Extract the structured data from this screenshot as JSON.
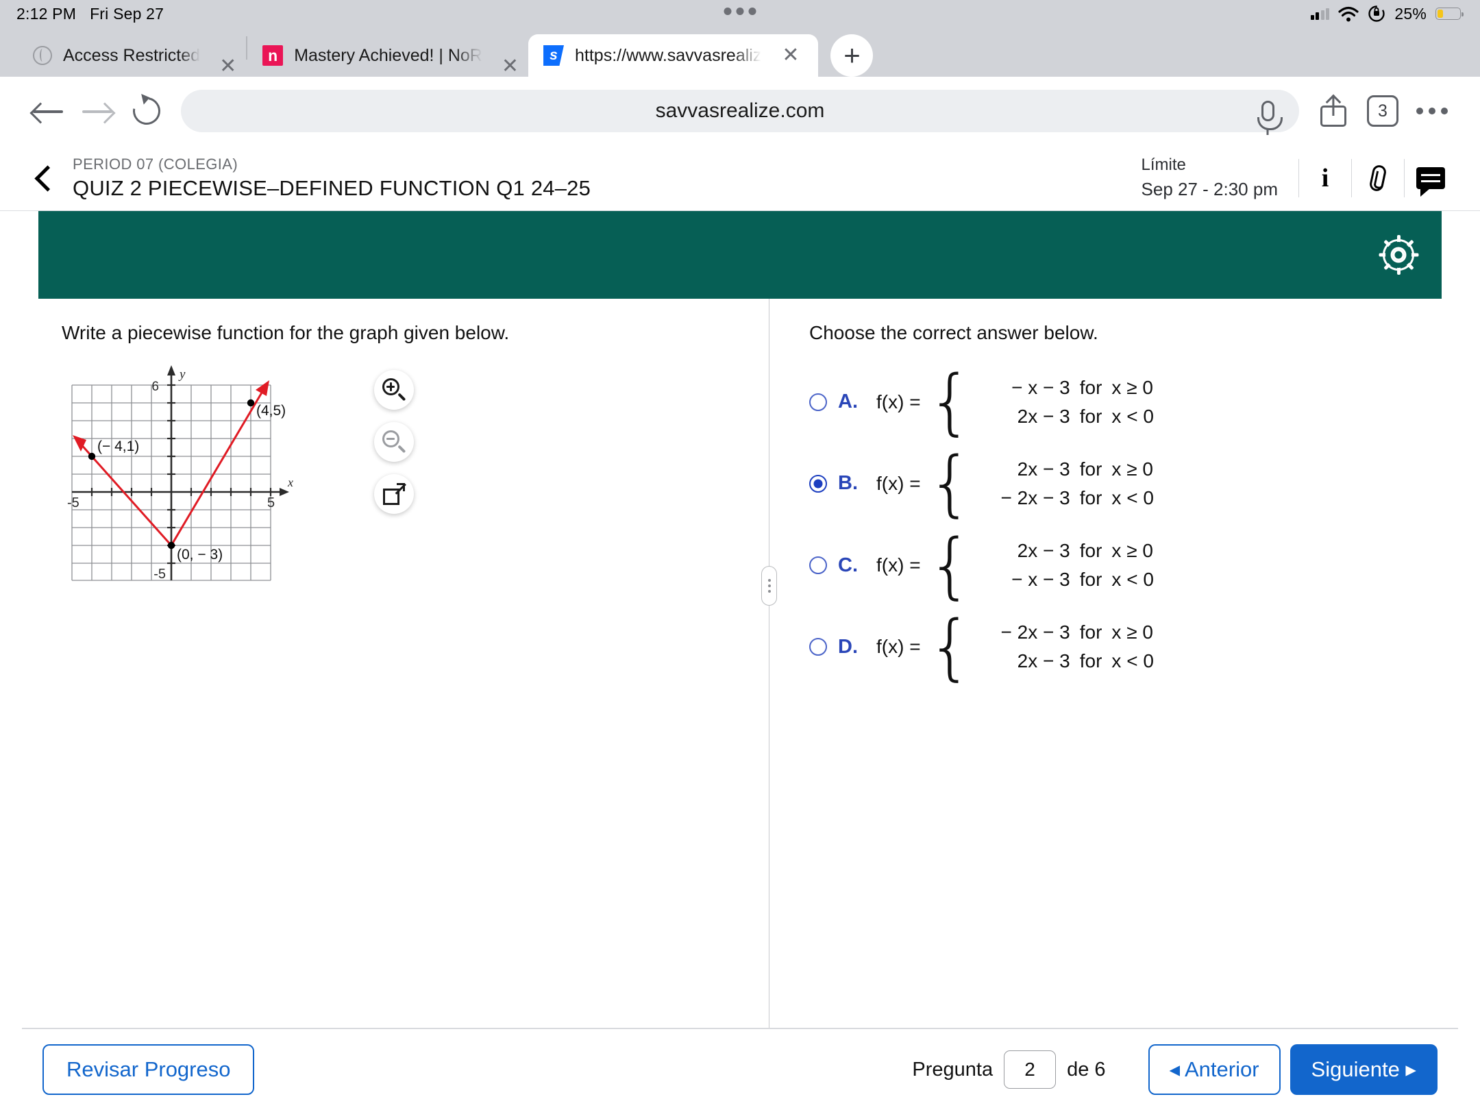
{
  "status_bar": {
    "time": "2:12 PM",
    "date": "Fri Sep 27",
    "battery_percent": "25%",
    "wifi_icon": "wifi-icon",
    "signal_icon": "cellular-signal-icon",
    "orientation_lock_icon": "rotation-lock-icon",
    "battery_icon": "battery-icon"
  },
  "browser": {
    "tabs": [
      {
        "title": "Access Restricted",
        "favicon": "globe-icon",
        "active": false
      },
      {
        "title": "Mastery Achieved! | NoR",
        "favicon": "notion-n-icon",
        "active": false
      },
      {
        "title": "https://www.savvasrealiz",
        "favicon": "savvas-s-icon",
        "active": true
      }
    ],
    "new_tab_label": "+",
    "close_label": "✕",
    "url": "savvasrealize.com",
    "tab_count": "3",
    "back_icon": "back-arrow-icon",
    "forward_icon": "forward-arrow-icon",
    "reload_icon": "reload-icon",
    "mic_icon": "microphone-icon",
    "share_icon": "share-icon",
    "more_icon": "more-options-icon"
  },
  "app_header": {
    "back_icon": "chevron-left-icon",
    "period": "PERIOD 07 (COLEGIA)",
    "title": "QUIZ 2 PIECEWISE–DEFINED FUNCTION Q1 24–25",
    "due_label": "Límite",
    "due_value": "Sep 27 - 2:30 pm",
    "info_icon": "info-icon",
    "attachment_icon": "paperclip-icon",
    "chat_icon": "chat-bubble-icon",
    "settings_icon": "gear-icon",
    "banner_color": "#065f55"
  },
  "question": {
    "prompt": "Write a piecewise function for the graph given below.",
    "choose_prompt": "Choose the correct answer below.",
    "tools": {
      "zoom_in_icon": "zoom-in-icon",
      "zoom_out_icon": "zoom-out-icon",
      "expand_icon": "open-in-new-icon"
    },
    "options": [
      {
        "letter": "A.",
        "fx": "f(x) =",
        "selected": false,
        "cases": [
          {
            "rhs": "− x − 3",
            "cond": "x ≥ 0"
          },
          {
            "rhs": "2x − 3",
            "cond": "x < 0"
          }
        ]
      },
      {
        "letter": "B.",
        "fx": "f(x) =",
        "selected": true,
        "cases": [
          {
            "rhs": "2x − 3",
            "cond": "x ≥ 0"
          },
          {
            "rhs": "− 2x − 3",
            "cond": "x < 0"
          }
        ]
      },
      {
        "letter": "C.",
        "fx": "f(x) =",
        "selected": false,
        "cases": [
          {
            "rhs": "2x − 3",
            "cond": "x ≥ 0"
          },
          {
            "rhs": "− x − 3",
            "cond": "x < 0"
          }
        ]
      },
      {
        "letter": "D.",
        "fx": "f(x) =",
        "selected": false,
        "cases": [
          {
            "rhs": "− 2x − 3",
            "cond": "x ≥ 0"
          },
          {
            "rhs": "2x − 3",
            "cond": "x < 0"
          }
        ]
      }
    ],
    "for_word": "for"
  },
  "chart_data": {
    "type": "line",
    "title": "",
    "xlabel": "x",
    "ylabel": "y",
    "xlim": [
      -5,
      5
    ],
    "ylim": [
      -5,
      6
    ],
    "grid": true,
    "x_tick_labels": [
      {
        "value": -5,
        "text": "-5"
      },
      {
        "value": 5,
        "text": "5"
      }
    ],
    "y_tick_labels": [
      {
        "value": 6,
        "text": "6"
      },
      {
        "value": -5,
        "text": "-5"
      }
    ],
    "series": [
      {
        "name": "left-branch",
        "color": "#e01b24",
        "arrow_at_start": true,
        "points": [
          [
            -4.6,
            2.2
          ],
          [
            0,
            -3
          ]
        ]
      },
      {
        "name": "right-branch",
        "color": "#e01b24",
        "arrow_at_end": true,
        "points": [
          [
            0,
            -3
          ],
          [
            4.6,
            6.2
          ]
        ]
      }
    ],
    "annotated_points": [
      {
        "x": -4,
        "y": 1,
        "label": "(− 4,1)"
      },
      {
        "x": 0,
        "y": -3,
        "label": "(0, − 3)"
      },
      {
        "x": 4,
        "y": 5,
        "label": "(4,5)"
      }
    ],
    "axis_color": "#333333",
    "grid_color": "#8d8f93"
  },
  "footer": {
    "review_progress_label": "Revisar Progreso",
    "question_label": "Pregunta",
    "question_number": "2",
    "of_label": "de 6",
    "prev_label": "◂ Anterior",
    "next_label": "Siguiente ▸"
  }
}
